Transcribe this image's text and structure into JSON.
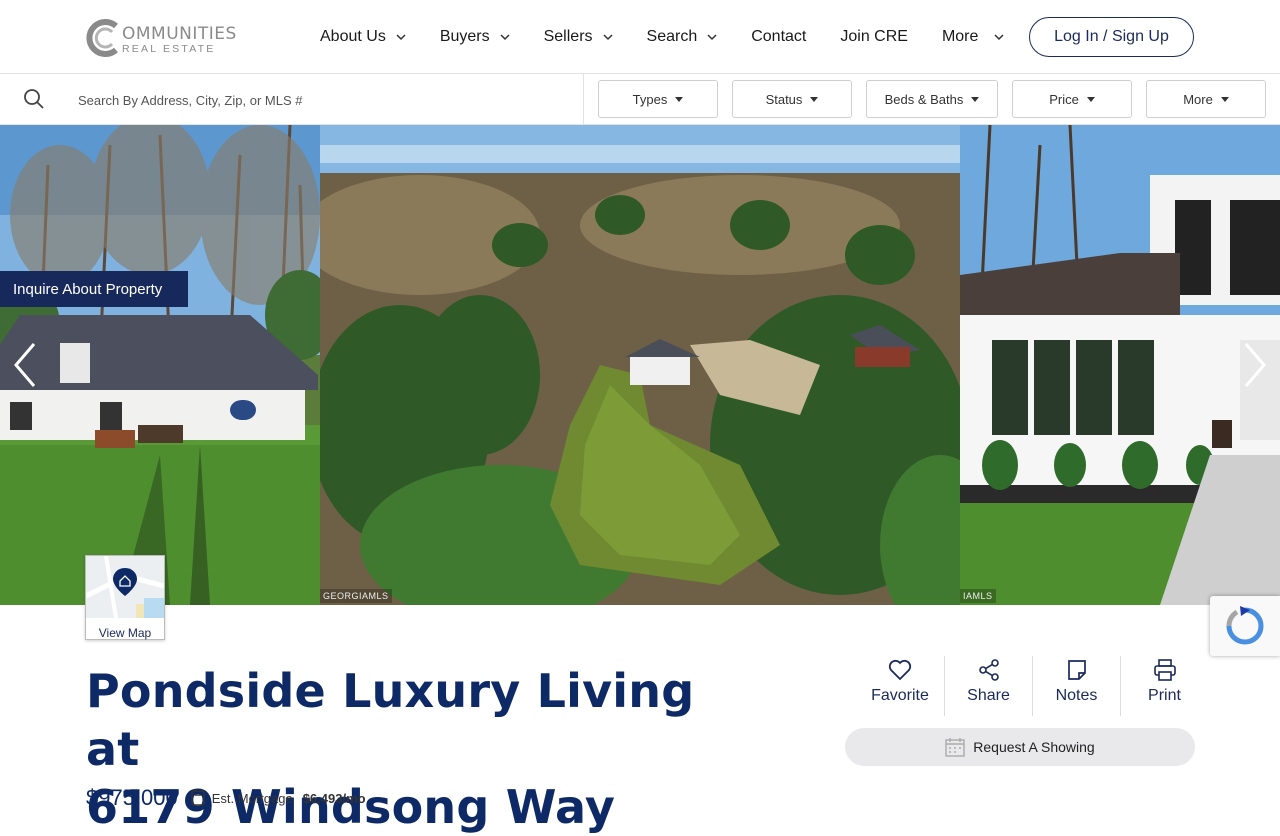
{
  "header": {
    "logo": {
      "main": "OMMUNITIES",
      "sub": "REAL ESTATE"
    },
    "nav": [
      {
        "label": "About Us",
        "dropdown": true
      },
      {
        "label": "Buyers",
        "dropdown": true
      },
      {
        "label": "Sellers",
        "dropdown": true
      },
      {
        "label": "Search",
        "dropdown": true
      },
      {
        "label": "Contact",
        "dropdown": false
      },
      {
        "label": "Join CRE",
        "dropdown": false
      },
      {
        "label": "More",
        "dropdown": true
      }
    ],
    "login_label": "Log In / Sign Up"
  },
  "search": {
    "placeholder": "Search By Address, City, Zip, or MLS #",
    "filters": [
      "Types",
      "Status",
      "Beds & Baths",
      "Price",
      "More"
    ]
  },
  "carousel": {
    "inquire_label": "Inquire About Property",
    "mls_left": "GEORGIAMLS",
    "mls_right": "IAMLS",
    "view_map_label": "View Map"
  },
  "listing": {
    "title_line1": "Pondside Luxury Living at",
    "title_line2": "6179 Windsong Way",
    "price": "$975,000",
    "est_label": "Est. Mortgage",
    "est_value": "$6,493/mo"
  },
  "actions": [
    {
      "label": "Favorite",
      "icon": "heart-icon"
    },
    {
      "label": "Share",
      "icon": "share-icon"
    },
    {
      "label": "Notes",
      "icon": "notes-icon"
    },
    {
      "label": "Print",
      "icon": "print-icon"
    }
  ],
  "request_showing_label": "Request A Showing",
  "colors": {
    "brand_navy": "#17295a",
    "title_blue": "#0e2a66",
    "button_gray": "#e9e9ec"
  }
}
